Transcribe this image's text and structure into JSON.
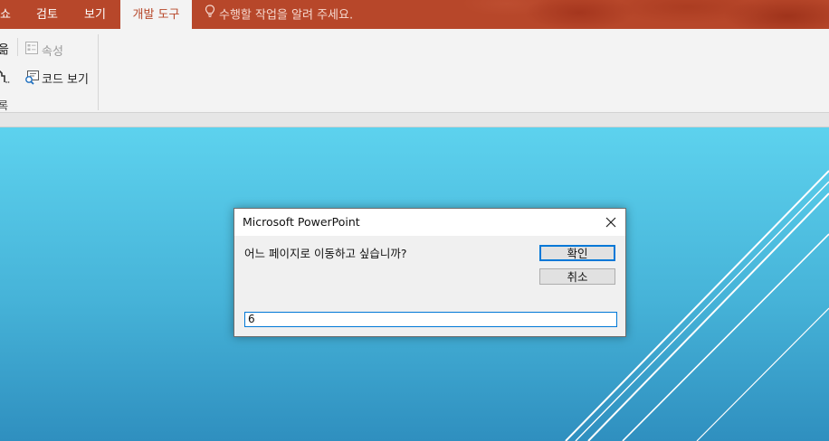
{
  "ribbon_tabs": {
    "partial_left": "쇼",
    "review": "검토",
    "view": "보기",
    "developer": "개발 도구"
  },
  "tell_me": {
    "placeholder": "수행할 작업을 알려 주세요.",
    "icon": "lightbulb-icon"
  },
  "ribbon": {
    "partial_left_top": "읆",
    "partial_left_bottom": "록",
    "properties_label": "속성",
    "properties_icon": "properties-icon",
    "view_code_label": "코드 보기",
    "view_code_icon": "view-code-icon",
    "tools_icon": "wrench-icon"
  },
  "dialog": {
    "title": "Microsoft PowerPoint",
    "prompt": "어느 페이지로 이동하고 싶습니까?",
    "ok_label": "확인",
    "cancel_label": "취소",
    "input_value": "6",
    "close_icon": "close-icon"
  },
  "colors": {
    "ribbon_accent": "#b7472a",
    "slide_top": "#5dd2ee",
    "slide_bottom": "#2f8fbf",
    "focus_blue": "#0078d7"
  }
}
